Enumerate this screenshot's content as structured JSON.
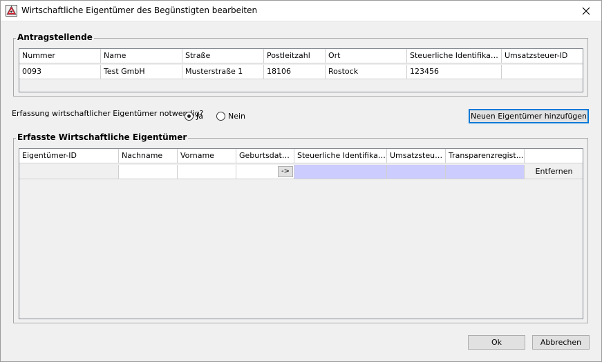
{
  "window": {
    "title": "Wirtschaftliche Eigentümer des Begünstigten bearbeiten",
    "close_glyph": "✕"
  },
  "antragstellende": {
    "legend": "Antragstellende",
    "columns": [
      "Nummer",
      "Name",
      "Straße",
      "Postleitzahl",
      "Ort",
      "Steuerliche Identifikation",
      "Umsatzsteuer-ID"
    ],
    "rows": [
      [
        "0093",
        "Test GmbH",
        "Musterstraße 1",
        "18106",
        "Rostock",
        "123456",
        ""
      ]
    ]
  },
  "question": {
    "label": "Erfassung wirtschaftlicher Eigentümer notwendig?",
    "options": [
      {
        "label": "Ja",
        "selected": true
      },
      {
        "label": "Nein",
        "selected": false
      }
    ]
  },
  "add_button": "Neuen Eigentümer hinzufügen",
  "eigentuemer": {
    "legend": "Erfasste Wirtschaftliche Eigentümer",
    "columns": [
      "Eigentümer-ID",
      "Nachname",
      "Vorname",
      "Geburtsdatum",
      "Steuerliche Identifikation",
      "Umsatzsteue...",
      "Transparenzregist...",
      ""
    ],
    "row": {
      "id": "",
      "nachname": "",
      "vorname": "",
      "geburtsdatum": "",
      "date_button": "->",
      "steuer_id": "",
      "ust_id": "",
      "transparenz": "",
      "remove_button": "Entfernen"
    }
  },
  "footer": {
    "ok": "Ok",
    "cancel": "Abbrechen"
  },
  "colors": {
    "selection": "#ccccff",
    "focus": "#0078d7"
  },
  "icons": {
    "app": "app-icon",
    "close": "close-icon"
  }
}
